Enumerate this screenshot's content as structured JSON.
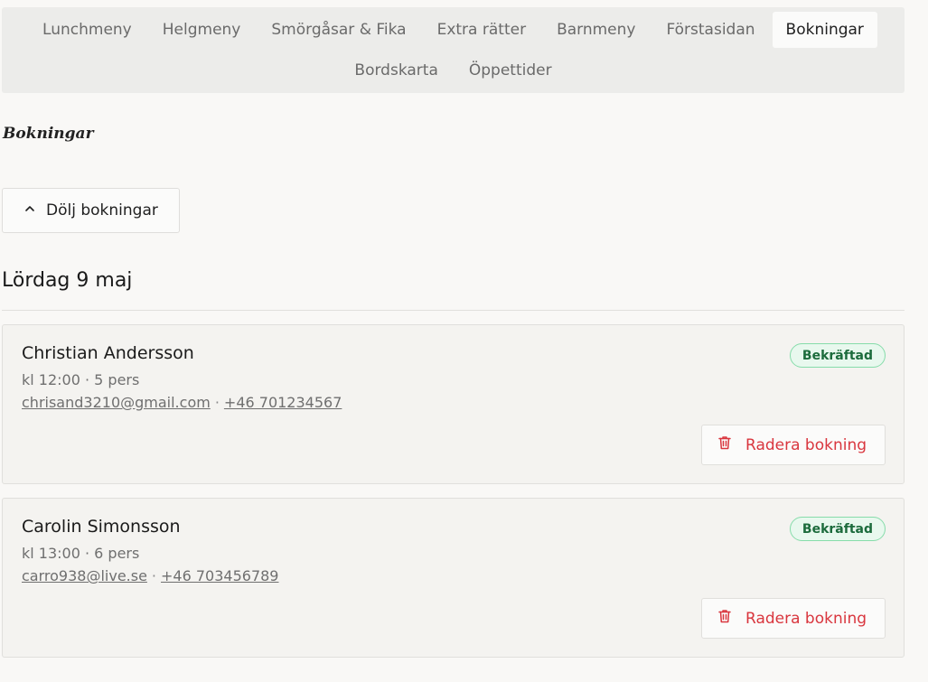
{
  "nav": {
    "tabs_row1": [
      {
        "label": "Lunchmeny"
      },
      {
        "label": "Helgmeny"
      },
      {
        "label": "Smörgåsar & Fika"
      },
      {
        "label": "Extra rätter"
      },
      {
        "label": "Barnmeny"
      },
      {
        "label": "Förstasidan"
      },
      {
        "label": "Bokningar",
        "active": true
      }
    ],
    "tabs_row2": [
      {
        "label": "Bordskarta"
      },
      {
        "label": "Öppettider"
      }
    ]
  },
  "page_title": "Bokningar",
  "toggle_button": {
    "label": "Dölj bokningar",
    "icon": "chevron-up-icon"
  },
  "day_heading": "Lördag 9 maj",
  "bookings": [
    {
      "name": "Christian Andersson",
      "meta": "kl 12:00 · 5 pers",
      "email": "chrisand3210@gmail.com",
      "separator": "·",
      "phone": "+46 701234567",
      "status": "Bekräftad",
      "delete_label": "Radera bokning",
      "delete_icon": "trash-icon"
    },
    {
      "name": "Carolin Simonsson",
      "meta": "kl 13:00 · 6 pers",
      "email": "carro938@live.se",
      "separator": "·",
      "phone": "+46 703456789",
      "status": "Bekräftad",
      "delete_label": "Radera bokning",
      "delete_icon": "trash-icon"
    }
  ],
  "colors": {
    "status_border": "#86dcaa",
    "status_text": "#1c6b3c",
    "danger": "#d9363e"
  }
}
